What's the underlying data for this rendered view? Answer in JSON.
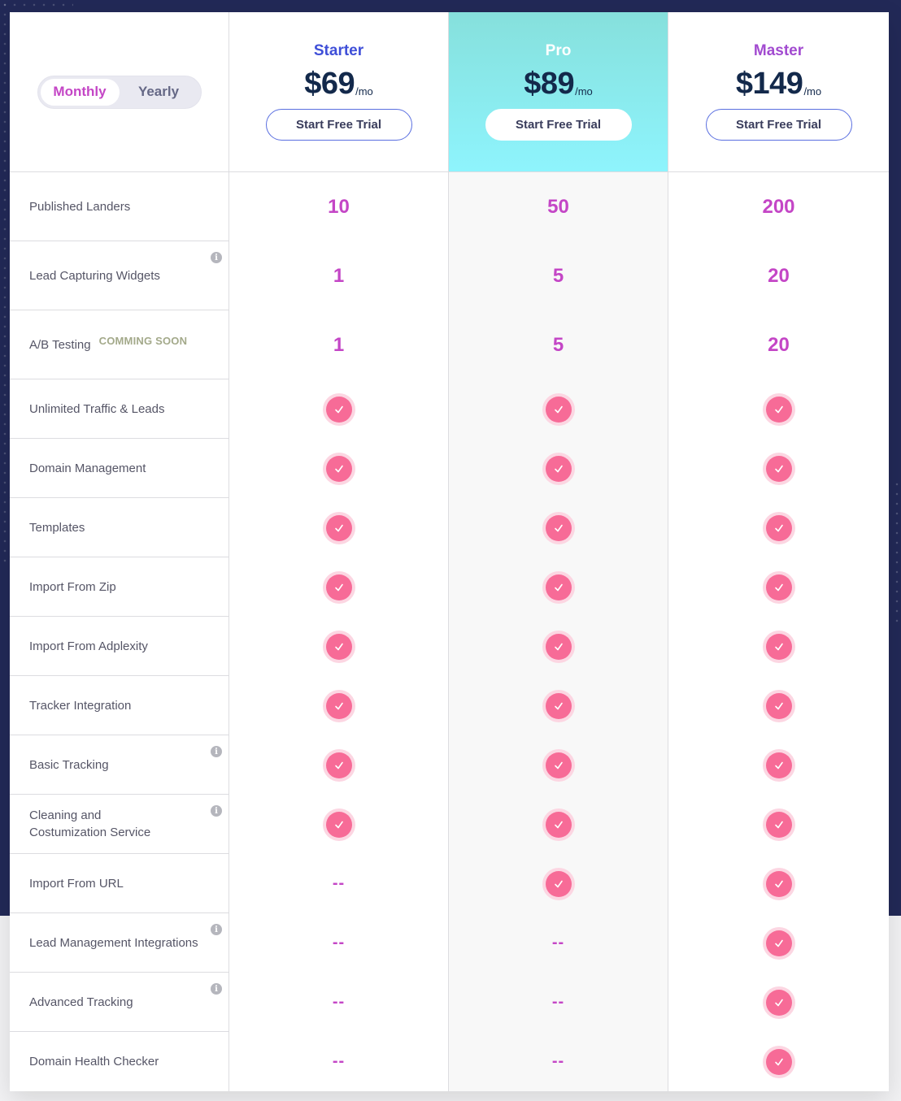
{
  "billing_toggle": {
    "monthly": "Monthly",
    "yearly": "Yearly",
    "selected": "Monthly"
  },
  "plans": [
    {
      "name": "Starter",
      "price": "$69",
      "period": "/mo",
      "cta": "Start Free Trial",
      "color": "#3f4fd8"
    },
    {
      "name": "Pro",
      "price": "$89",
      "period": "/mo",
      "cta": "Start Free Trial",
      "color": "#ffffff"
    },
    {
      "name": "Master",
      "price": "$149",
      "period": "/mo",
      "cta": "Start Free Trial",
      "color": "#a24bd0"
    }
  ],
  "features": [
    {
      "label": "Published Landers",
      "info": false,
      "values": [
        "10",
        "50",
        "200"
      ]
    },
    {
      "label": "Lead Capturing Widgets",
      "info": true,
      "values": [
        "1",
        "5",
        "20"
      ]
    },
    {
      "label": "A/B Testing",
      "badge": "COMMING SOON",
      "info": false,
      "values": [
        "1",
        "5",
        "20"
      ]
    },
    {
      "label": "Unlimited Traffic & Leads",
      "info": false,
      "values": [
        "check",
        "check",
        "check"
      ]
    },
    {
      "label": "Domain Management",
      "info": false,
      "values": [
        "check",
        "check",
        "check"
      ]
    },
    {
      "label": "Templates",
      "info": false,
      "values": [
        "check",
        "check",
        "check"
      ]
    },
    {
      "label": "Import From Zip",
      "info": false,
      "values": [
        "check",
        "check",
        "check"
      ]
    },
    {
      "label": "Import From Adplexity",
      "info": false,
      "values": [
        "check",
        "check",
        "check"
      ]
    },
    {
      "label": "Tracker Integration",
      "info": false,
      "values": [
        "check",
        "check",
        "check"
      ]
    },
    {
      "label": "Basic Tracking",
      "info": true,
      "values": [
        "check",
        "check",
        "check"
      ]
    },
    {
      "label": "Cleaning and Costumization Service",
      "info": true,
      "values": [
        "check",
        "check",
        "check"
      ]
    },
    {
      "label": "Import From URL",
      "info": false,
      "values": [
        "--",
        "check",
        "check"
      ]
    },
    {
      "label": "Lead Management Integrations",
      "info": true,
      "values": [
        "--",
        "--",
        "check"
      ]
    },
    {
      "label": "Advanced Tracking",
      "info": true,
      "values": [
        "--",
        "--",
        "check"
      ]
    },
    {
      "label": "Domain Health Checker",
      "info": false,
      "values": [
        "--",
        "--",
        "check"
      ]
    }
  ],
  "icons": {
    "check": "check-icon",
    "info": "info-icon"
  },
  "colors": {
    "accent": "#c446c6",
    "check": "#f76b97",
    "background": "#222957",
    "featured_top": "#86e0dc",
    "featured_bottom": "#8ef4fd"
  }
}
